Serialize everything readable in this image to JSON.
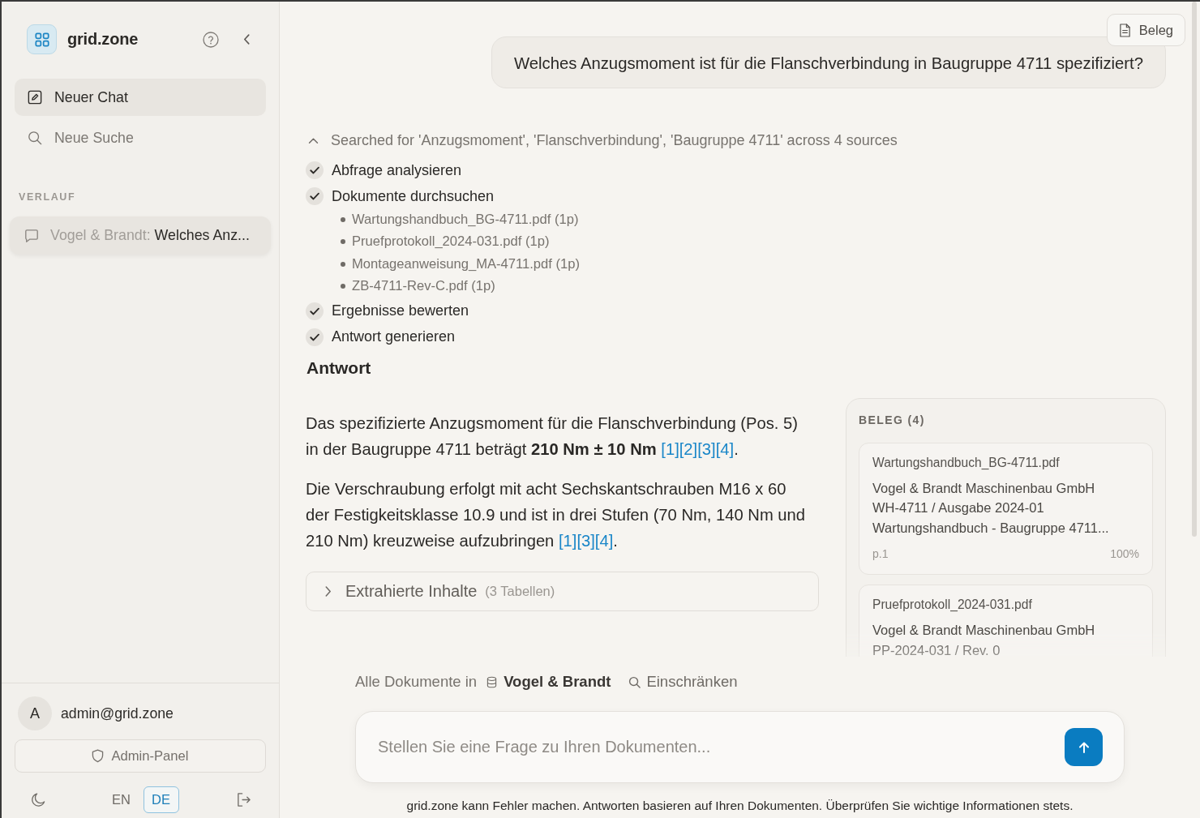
{
  "sidebar": {
    "brand": "grid.zone",
    "nav": [
      {
        "kind": "compose",
        "label": "Neuer Chat",
        "selected": true
      },
      {
        "kind": "search",
        "label": "Neue Suche",
        "selected": false
      }
    ],
    "history_label": "VERLAUF",
    "history": [
      {
        "workspace": "Vogel & Brandt:",
        "title": "Welches Anz...",
        "selected": true
      }
    ],
    "user": {
      "initial": "A",
      "email": "admin@grid.zone"
    },
    "admin_button": "Admin-Panel",
    "languages": [
      {
        "label": "EN",
        "selected": false
      },
      {
        "label": "DE",
        "selected": true
      }
    ]
  },
  "header": {
    "evidence_button": "Beleg"
  },
  "question": "Welches Anzugsmoment ist für die Flanschverbindung in Baugruppe 4711 spezifiziert?",
  "search_trace": {
    "expanded": true,
    "summary": "Searched for 'Anzugsmoment', 'Flanschverbindung', 'Baugruppe 4711' across 4 sources",
    "steps": [
      {
        "label": "Abfrage analysieren",
        "done": true
      },
      {
        "label": "Dokumente durchsuchen",
        "done": true,
        "documents": [
          "Wartungshandbuch_BG-4711.pdf (1p)",
          "Pruefprotokoll_2024-031.pdf (1p)",
          "Montageanweisung_MA-4711.pdf (1p)",
          "ZB-4711-Rev-C.pdf (1p)"
        ]
      },
      {
        "label": "Ergebnisse bewerten",
        "done": true
      },
      {
        "label": "Antwort generieren",
        "done": true
      }
    ]
  },
  "answer": {
    "heading": "Antwort",
    "paragraphs": [
      {
        "text": "Das spezifizierte Anzugsmoment für die Flanschverbindung (Pos. 5) in der Baugruppe 4711 beträgt **210 Nm ± 10 Nm** ",
        "citations": [
          "[1]",
          "[2]",
          "[3]",
          "[4]"
        ],
        "end": "."
      },
      {
        "text": "Die Verschraubung erfolgt mit acht Sechskantschrauben M16 x 60 der Festigkeitsklasse 10.9 und ist in drei Stufen (70 Nm, 140 Nm und 210 Nm) kreuzweise aufzubringen ",
        "citations": [
          "[1]",
          "[3]",
          "[4]"
        ],
        "end": "."
      }
    ],
    "extracted": {
      "label": "Extrahierte Inhalte",
      "count": "(3 Tabellen)",
      "expanded": false
    }
  },
  "evidence": {
    "title": "BELEG (4)",
    "cards": [
      {
        "file": "Wartungshandbuch_BG-4711.pdf",
        "lines": [
          "Vogel & Brandt Maschinenbau GmbH",
          "WH-4711 / Ausgabe 2024-01",
          "Wartungshandbuch - Baugruppe 4711..."
        ],
        "page": "p.1",
        "score": "100%"
      },
      {
        "file": "Pruefprotokoll_2024-031.pdf",
        "lines": [
          "Vogel & Brandt Maschinenbau GmbH",
          "PP-2024-031 / Rev. 0"
        ]
      }
    ]
  },
  "composer": {
    "scope_prefix": "Alle Dokumente in",
    "workspace": "Vogel & Brandt",
    "filter_button": "Einschränken",
    "placeholder": "Stellen Sie eine Frage zu Ihren Dokumenten...",
    "disclaimer": "grid.zone kann Fehler machen. Antworten basieren auf Ihren Dokumenten. Überprüfen Sie wichtige Informationen stets."
  }
}
